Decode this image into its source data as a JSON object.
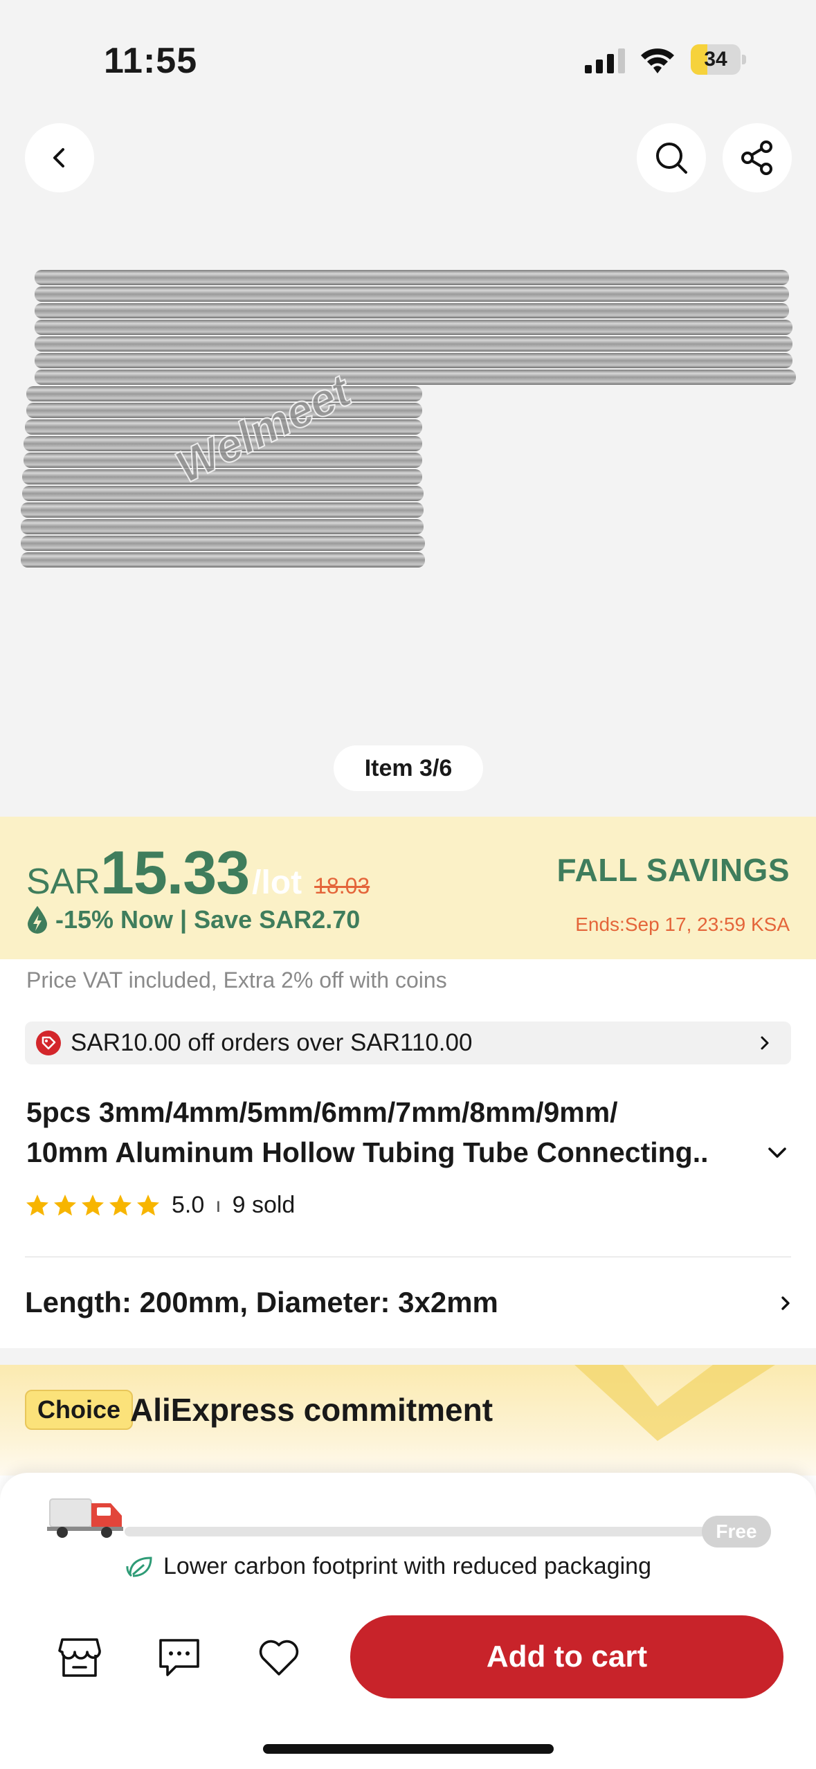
{
  "status_bar": {
    "time": "11:55",
    "battery_percent": "34",
    "battery_level": 0.34,
    "signal_icon": "cellular-signal-icon",
    "wifi_icon": "wifi-icon"
  },
  "gallery": {
    "watermark": "Welmeet",
    "item_indicator": "Item 3/6"
  },
  "nav": {
    "back_icon": "back-chevron-icon",
    "search_icon": "search-icon",
    "share_icon": "share-icon"
  },
  "price": {
    "currency": "SAR",
    "amount": "15.33",
    "unit": "/lot",
    "original": "18.03",
    "discount_text": "-15% Now | Save SAR2.70",
    "campaign": "FALL SAVINGS",
    "campaign_end": "Ends:Sep 17, 23:59 KSA",
    "accent_color": "#3f7d5c",
    "highlight_color": "#e4653a"
  },
  "vat_note": "Price VAT included, Extra 2% off with coins",
  "coupon": {
    "text": "SAR10.00 off orders over SAR110.00"
  },
  "product": {
    "title_line1": "5pcs 3mm/4mm/5mm/6mm/7mm/8mm/9mm/",
    "title_line2": "10mm Aluminum Hollow Tubing Tube Connecting..",
    "rating": "5.0",
    "rating_stars": 5,
    "separator": "ı",
    "sold": "9 sold"
  },
  "variant": {
    "label": "Length: 200mm, Diameter: 3x2mm"
  },
  "commitment": {
    "badge": "Choice",
    "title": "AliExpress commitment"
  },
  "shipping": {
    "free_label": "Free",
    "progress": 0.0,
    "eco_text": "Lower carbon footprint with reduced packaging"
  },
  "actions": {
    "store_icon": "store-icon",
    "chat_icon": "chat-icon",
    "wishlist_icon": "heart-icon",
    "add_to_cart": "Add to cart",
    "brand_color": "#c8232a"
  }
}
